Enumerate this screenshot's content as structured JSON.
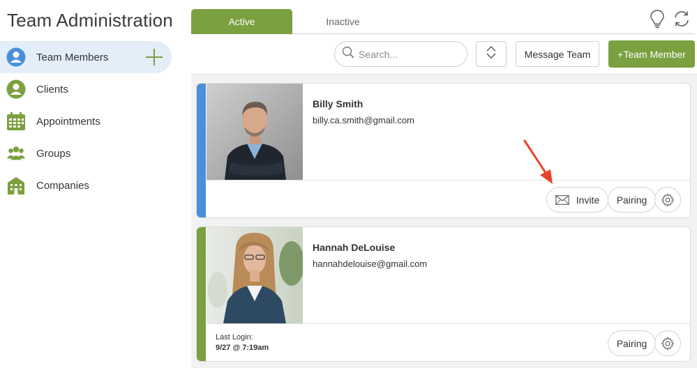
{
  "app": {
    "title": "Team Administration"
  },
  "sidebar": {
    "items": [
      {
        "label": "Team Members",
        "icon": "person-icon",
        "active": true
      },
      {
        "label": "Clients",
        "icon": "client-icon"
      },
      {
        "label": "Appointments",
        "icon": "calendar-icon"
      },
      {
        "label": "Groups",
        "icon": "group-icon"
      },
      {
        "label": "Companies",
        "icon": "building-icon"
      }
    ],
    "add_icon": "plus-icon"
  },
  "tabs": [
    {
      "label": "Active",
      "active": true
    },
    {
      "label": "Inactive",
      "active": false
    }
  ],
  "header_icons": [
    "lightbulb-icon",
    "refresh-icon"
  ],
  "toolbar": {
    "search_placeholder": "Search...",
    "sort_icon": "sort-chevrons-icon",
    "message_label": "Message Team",
    "add_member_label": "+Team Member"
  },
  "members": [
    {
      "name": "Billy Smith",
      "email": "billy.ca.smith@gmail.com",
      "stripe_color": "#4a90d9",
      "actions": {
        "invite_label": "Invite",
        "pairing_label": "Pairing"
      }
    },
    {
      "name": "Hannah DeLouise",
      "email": "hannahdelouise@gmail.com",
      "stripe_color": "#7aa03f",
      "last_login_label": "Last Login:",
      "last_login_value": "9/27 @ 7:19am",
      "actions": {
        "pairing_label": "Pairing"
      }
    }
  ],
  "colors": {
    "accent": "#7aa03f",
    "blue": "#4a90d9",
    "annotation": "#e8432a"
  }
}
